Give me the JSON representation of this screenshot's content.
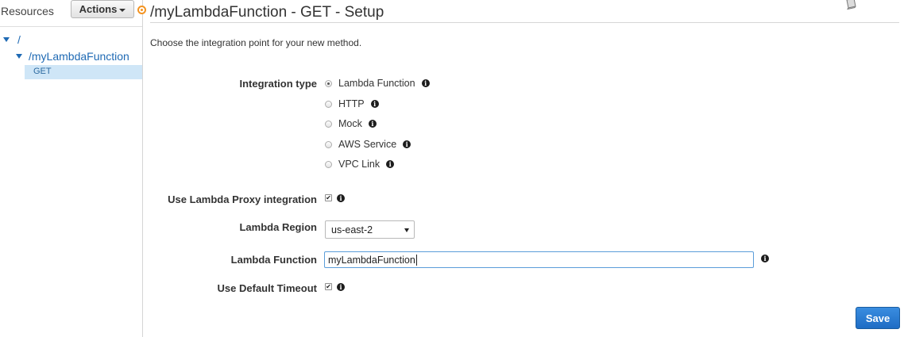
{
  "sidebar": {
    "resources_label": "Resources",
    "actions_label": "Actions",
    "tree": {
      "root": "/",
      "resource": "/myLambdaFunction",
      "method": "GET"
    }
  },
  "header": {
    "title": "/myLambdaFunction - GET - Setup"
  },
  "form": {
    "intro": "Choose the integration point for your new method.",
    "integration_type_label": "Integration type",
    "integration_options": [
      {
        "label": "Lambda Function",
        "selected": true
      },
      {
        "label": "HTTP",
        "selected": false
      },
      {
        "label": "Mock",
        "selected": false
      },
      {
        "label": "AWS Service",
        "selected": false
      },
      {
        "label": "VPC Link",
        "selected": false
      }
    ],
    "proxy_label": "Use Lambda Proxy integration",
    "proxy_checked": true,
    "region_label": "Lambda Region",
    "region_value": "us-east-2",
    "function_label": "Lambda Function",
    "function_value": "myLambdaFunction",
    "timeout_label": "Use Default Timeout",
    "timeout_checked": true,
    "save_label": "Save"
  },
  "icons": {
    "info": "info-icon",
    "book": "book-icon",
    "checkmark": "✔"
  },
  "colors": {
    "accent": "#1f6ab4",
    "selection_dot": "#f39321",
    "save_button": "#1e6cc4",
    "selected_row": "#cfe6f7"
  }
}
